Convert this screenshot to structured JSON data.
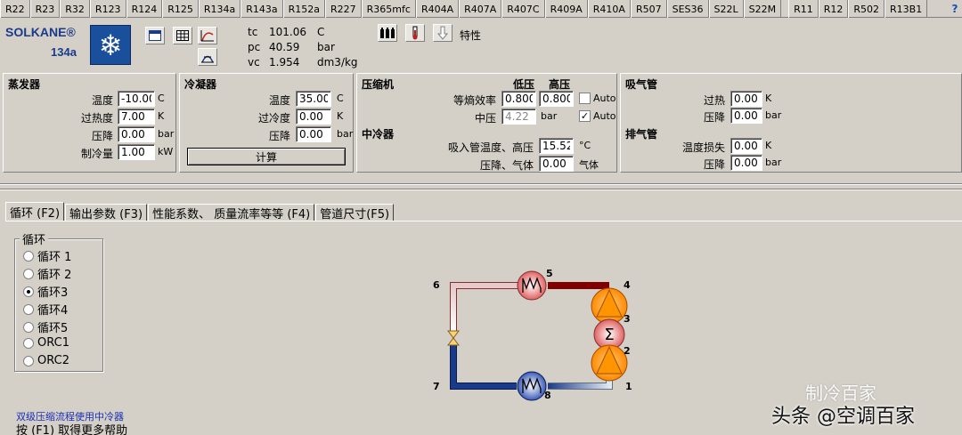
{
  "refrigerants": [
    "R22",
    "R23",
    "R32",
    "R123",
    "R124",
    "R125",
    "R134a",
    "R143a",
    "R152a",
    "R227",
    "R365mfc",
    "R404A",
    "R407A",
    "R407C",
    "R409A",
    "R410A",
    "R507",
    "SES36",
    "S22L",
    "S22M",
    "R11",
    "R12",
    "R502",
    "R13B1"
  ],
  "help_glyph": "?",
  "logo": {
    "brand": "SOLKANE®",
    "model": "134a",
    "glyph": "❄"
  },
  "props": [
    {
      "sym": "tc",
      "val": "101.06",
      "unit": "C"
    },
    {
      "sym": "pc",
      "val": "40.59",
      "unit": "bar"
    },
    {
      "sym": "vc",
      "val": "1.954",
      "unit": "dm3/kg"
    }
  ],
  "char_label": "特性",
  "evaporator": {
    "title": "蒸发器",
    "rows": [
      {
        "label": "温度",
        "value": "-10.00",
        "unit": "C"
      },
      {
        "label": "过热度",
        "value": "7.00",
        "unit": "K"
      },
      {
        "label": "压降",
        "value": "0.00",
        "unit": "bar"
      },
      {
        "label": "制冷量",
        "value": "1.00",
        "unit": "kW"
      }
    ]
  },
  "condenser": {
    "title": "冷凝器",
    "rows": [
      {
        "label": "温度",
        "value": "35.00",
        "unit": "C"
      },
      {
        "label": "过冷度",
        "value": "0.00",
        "unit": "K"
      },
      {
        "label": "压降",
        "value": "0.00",
        "unit": "bar"
      }
    ],
    "calc_label": "计算"
  },
  "compressor": {
    "title": "压缩机",
    "col_low": "低压",
    "col_high": "高压",
    "eff_label": "等熵效率",
    "eff_low": "0.800",
    "eff_high": "0.800",
    "auto1": "Auto",
    "mid_label": "中压",
    "mid_value": "4.22",
    "mid_unit": "bar",
    "auto2": "Auto",
    "intercooler_title": "中冷器",
    "suct_label": "吸入管温度、高压",
    "suct_value": "15.52",
    "suct_unit": "°C",
    "dp_label": "压降、气体",
    "dp_value": "0.00",
    "dp_unit": "气体"
  },
  "suction": {
    "title": "吸气管",
    "rows": [
      {
        "label": "过热",
        "value": "0.00",
        "unit": "K"
      },
      {
        "label": "压降",
        "value": "0.00",
        "unit": "bar"
      }
    ]
  },
  "discharge": {
    "title": "排气管",
    "rows": [
      {
        "label": "温度损失",
        "value": "0.00",
        "unit": "K"
      },
      {
        "label": "压降",
        "value": "0.00",
        "unit": "bar"
      }
    ]
  },
  "tabs": [
    "循环 (F2)",
    "输出参数 (F3)",
    "性能系数、 质量流率等等 (F4)",
    "管道尺寸(F5)"
  ],
  "cycle_group": {
    "title": "循环",
    "options": [
      "循环 1",
      "循环 2",
      "循环3",
      "循环4",
      "循环5",
      "ORC1",
      "ORC2"
    ],
    "selected": 2
  },
  "diagram_labels": [
    "1",
    "2",
    "3",
    "4",
    "5",
    "6",
    "7",
    "8"
  ],
  "note": "双级压缩流程使用中冷器",
  "hint": "按 (F1) 取得更多帮助",
  "watermark_top": "制冷百家",
  "watermark_bottom": "头条 @空调百家",
  "colors": {
    "hot": "#d02020",
    "cold": "#1a3a8a",
    "pump": "#ff9900"
  }
}
